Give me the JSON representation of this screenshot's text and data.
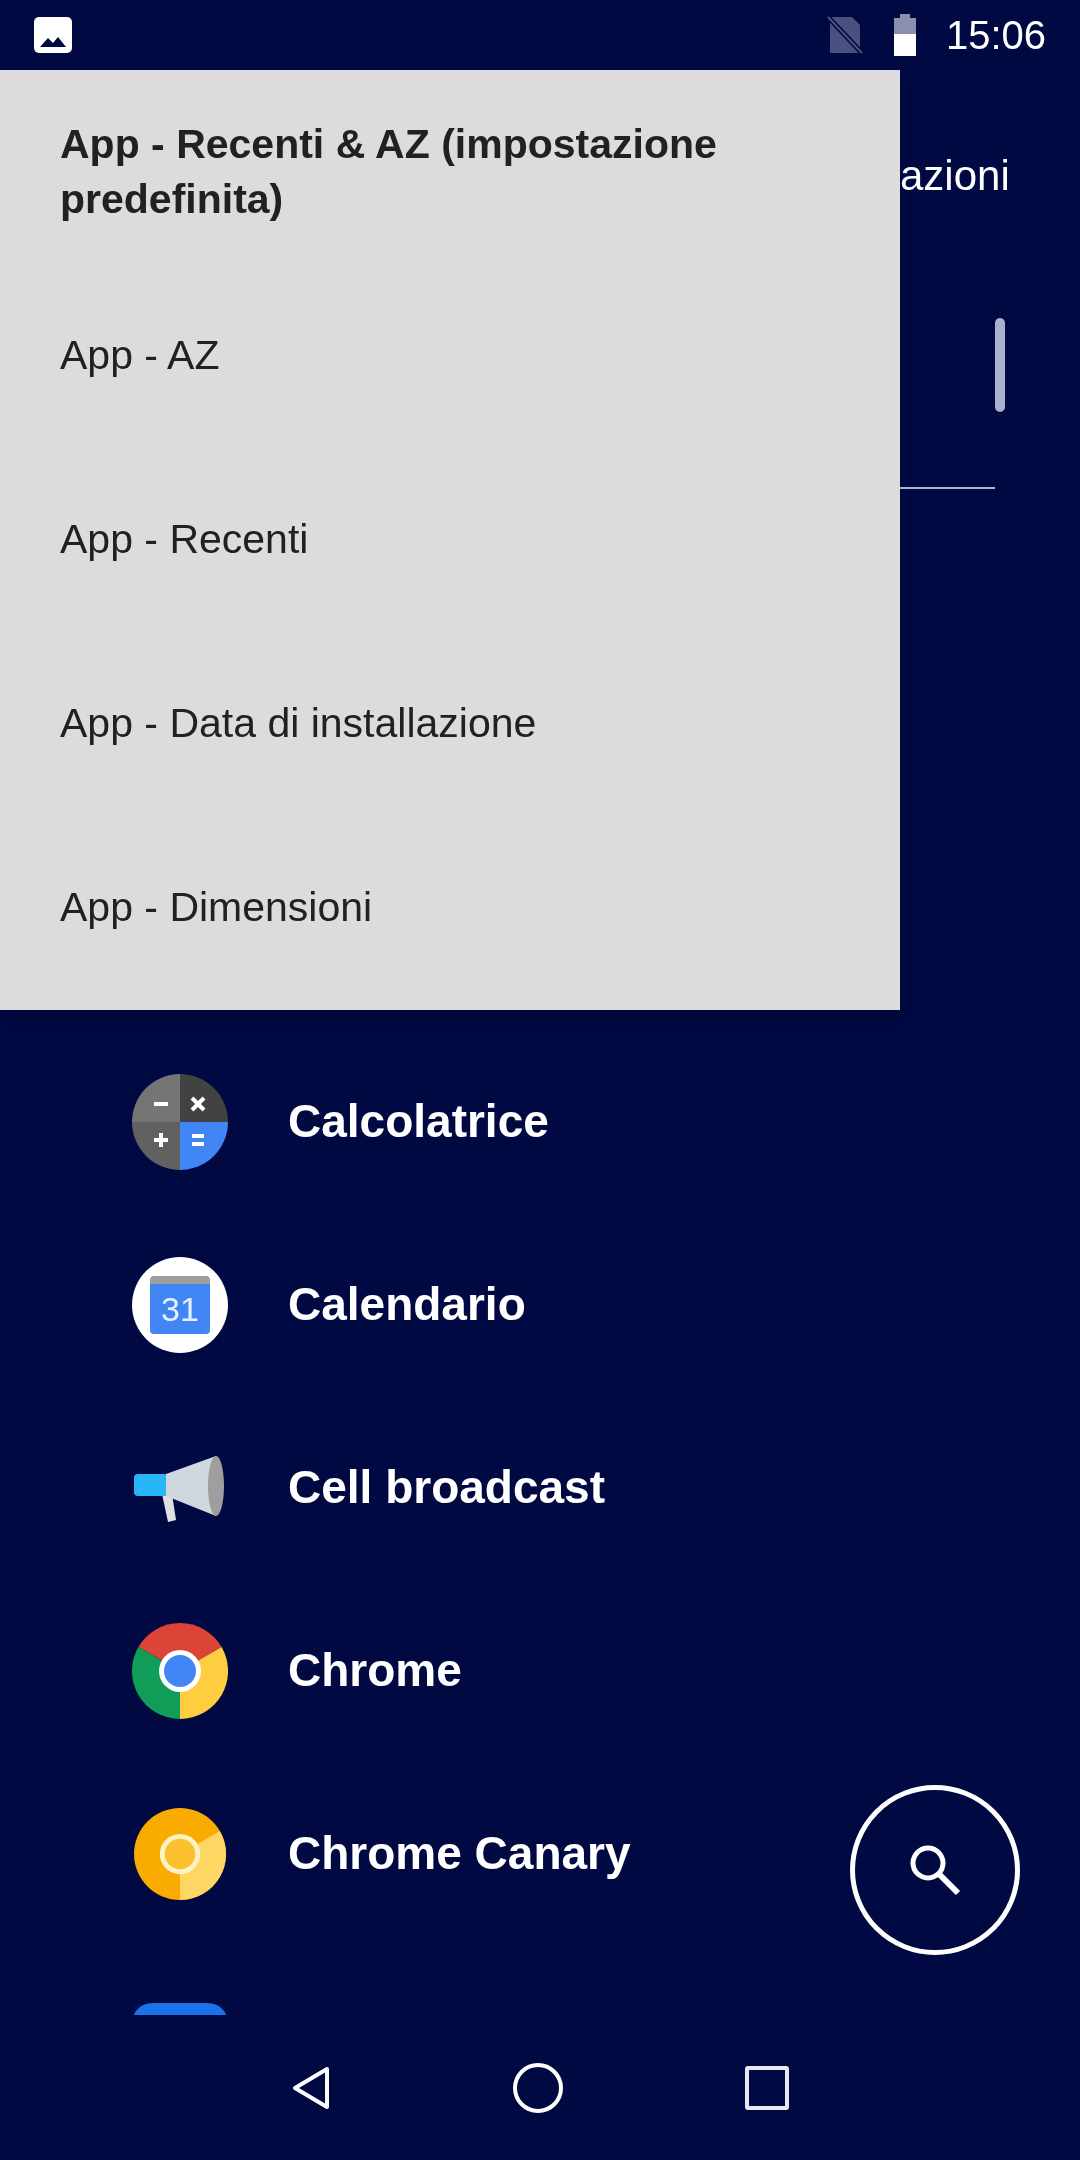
{
  "status_bar": {
    "time": "15:06"
  },
  "header": {
    "title": "azioni"
  },
  "sort_menu": [
    {
      "label": "App - Recenti & AZ (impostazione predefinita)",
      "selected": true
    },
    {
      "label": "App - AZ",
      "selected": false
    },
    {
      "label": "App - Recenti",
      "selected": false
    },
    {
      "label": "App - Data di installazione",
      "selected": false
    },
    {
      "label": "App - Dimensioni",
      "selected": false
    }
  ],
  "apps": [
    {
      "kind": "calculator",
      "name": "Calcolatrice"
    },
    {
      "kind": "calendar",
      "name": "Calendario",
      "icon_text": "31"
    },
    {
      "kind": "megaphone",
      "name": "Cell broadcast"
    },
    {
      "kind": "chrome",
      "name": "Chrome"
    },
    {
      "kind": "canary",
      "name": "Chrome Canary"
    },
    {
      "kind": "partial"
    }
  ]
}
